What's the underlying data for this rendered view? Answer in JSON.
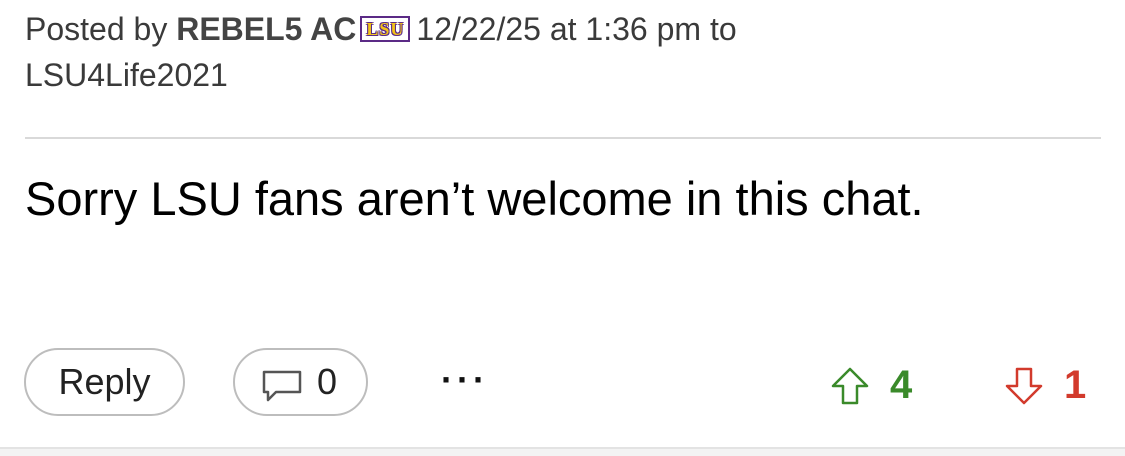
{
  "post": {
    "posted_by_prefix": "Posted by",
    "author": "REBEL5 AC",
    "team_badge": "LSU",
    "timestamp": "12/22/25 at 1:36 pm to",
    "reply_to": "LSU4Life2021",
    "body": "Sorry LSU fans aren’t welcome in this chat."
  },
  "actions": {
    "reply_label": "Reply",
    "comment_count": "0",
    "more_label": "···",
    "upvotes": "4",
    "downvotes": "1"
  },
  "colors": {
    "upvote": "#3a8a2a",
    "downvote": "#d23a2c",
    "badge_gold": "#f2c318",
    "badge_purple": "#5b2a86"
  },
  "icons": {
    "comment": "comment-bubble-icon",
    "upvote": "arrow-up-icon",
    "downvote": "arrow-down-icon"
  }
}
